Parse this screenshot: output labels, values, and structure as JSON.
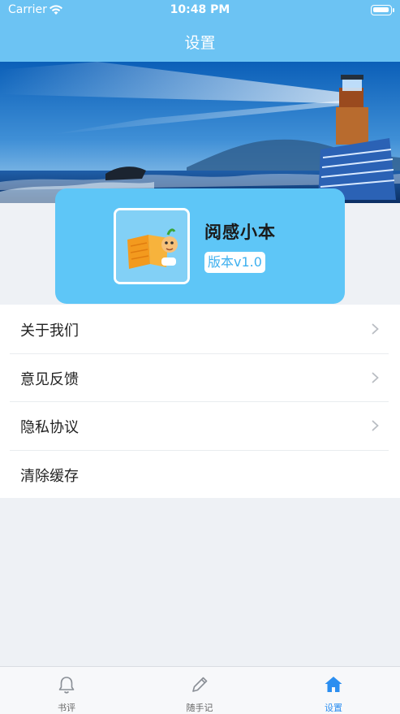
{
  "status_bar": {
    "carrier": "Carrier",
    "time": "10:48 PM"
  },
  "nav": {
    "title": "设置"
  },
  "app_card": {
    "name": "阅感小本",
    "version": "版本v1.0"
  },
  "menu": {
    "items": [
      {
        "label": "关于我们",
        "has_chevron": true
      },
      {
        "label": "意见反馈",
        "has_chevron": true
      },
      {
        "label": "隐私协议",
        "has_chevron": true
      },
      {
        "label": "清除缓存",
        "has_chevron": false
      }
    ]
  },
  "tabs": [
    {
      "label": "书评",
      "icon": "bell-icon",
      "active": false
    },
    {
      "label": "随手记",
      "icon": "pencil-icon",
      "active": false
    },
    {
      "label": "设置",
      "icon": "home-icon",
      "active": true
    }
  ],
  "colors": {
    "nav_bg": "#6cc3f3",
    "card_bg": "#5ec6f7",
    "accent": "#2b8ef0"
  }
}
